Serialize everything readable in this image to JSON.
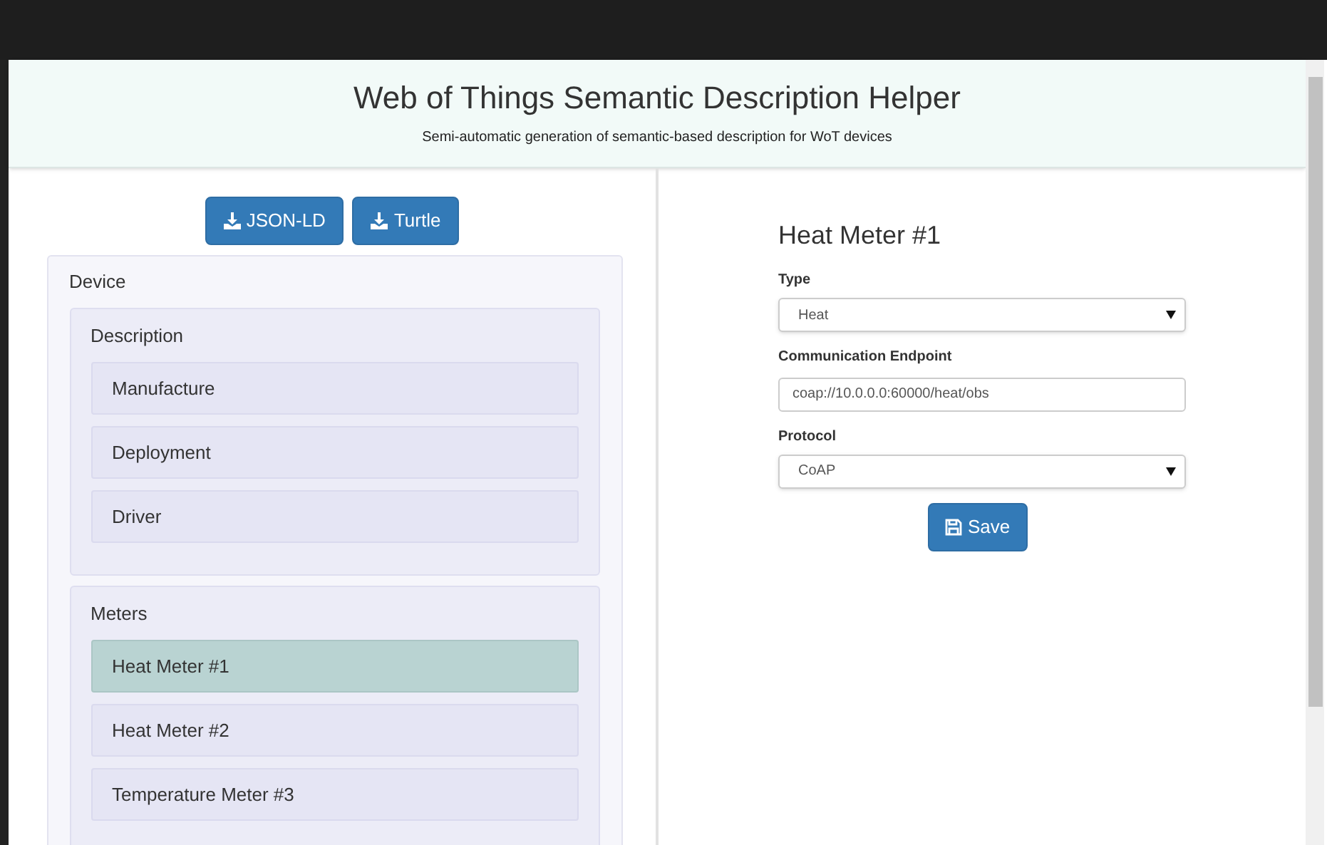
{
  "header": {
    "title": "Web of Things Semantic Description Helper",
    "subtitle": "Semi-automatic generation of semantic-based description for WoT devices"
  },
  "export_buttons": [
    "JSON-LD",
    "Turtle"
  ],
  "tree": {
    "label": "Device",
    "children": [
      {
        "label": "Description",
        "children": [
          {
            "label": "Manufacture",
            "selected": false
          },
          {
            "label": "Deployment",
            "selected": false
          },
          {
            "label": "Driver",
            "selected": false
          }
        ]
      },
      {
        "label": "Meters",
        "children": [
          {
            "label": "Heat Meter #1",
            "selected": true
          },
          {
            "label": "Heat Meter #2",
            "selected": false
          },
          {
            "label": "Temperature Meter #3",
            "selected": false
          }
        ]
      }
    ]
  },
  "form": {
    "title": "Heat Meter #1",
    "fields": [
      {
        "kind": "select",
        "label": "Type",
        "value": "Heat"
      },
      {
        "kind": "text",
        "label": "Communication Endpoint",
        "value": "coap://10.0.0.0:60000/heat/obs"
      },
      {
        "kind": "select",
        "label": "Protocol",
        "value": "CoAP"
      }
    ],
    "save_button": "Save"
  }
}
